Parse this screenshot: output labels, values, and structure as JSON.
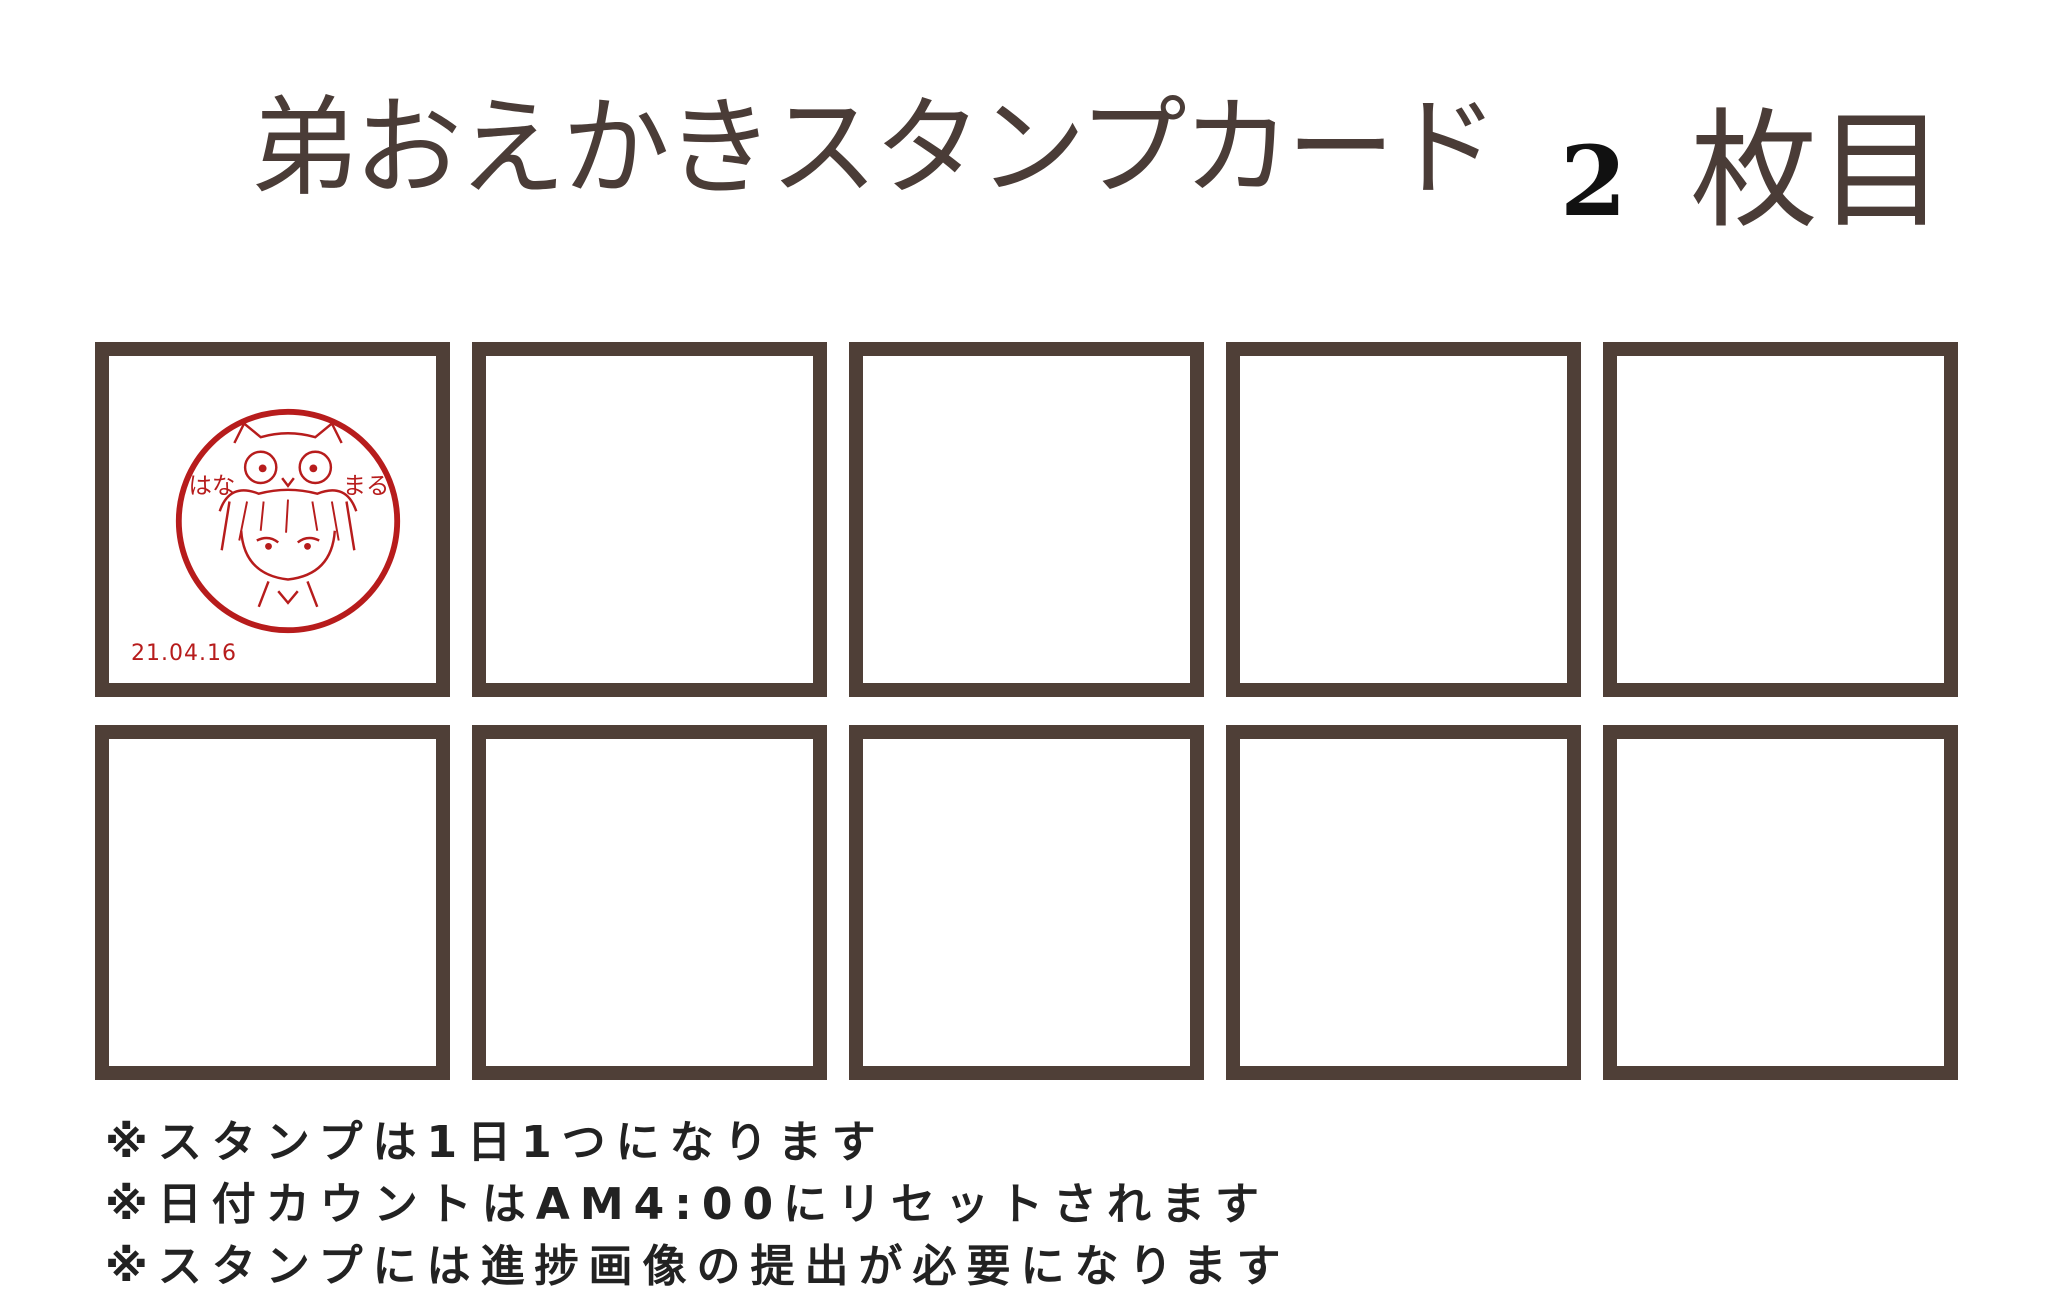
{
  "header": {
    "title": "弟おえかきスタンプカード",
    "card_number": "2",
    "card_suffix": "枚目"
  },
  "grid": {
    "rows": 2,
    "columns": 5,
    "total_slots": 10,
    "stamped_count": 1
  },
  "stamps": [
    {
      "slot": 1,
      "label_left": "はな",
      "label_right": "まる",
      "date": "21.04.16",
      "color": "#b71c1c"
    }
  ],
  "notes": [
    "※スタンプは1日1つになります",
    "※日付カウントはAM4:00にリセットされます",
    "※スタンプには進捗画像の提出が必要になります"
  ],
  "colors": {
    "frame": "#4f3f37",
    "title_text": "#4a3c37",
    "card_number": "#111111",
    "note_text": "#222222",
    "stamp": "#b71c1c"
  }
}
